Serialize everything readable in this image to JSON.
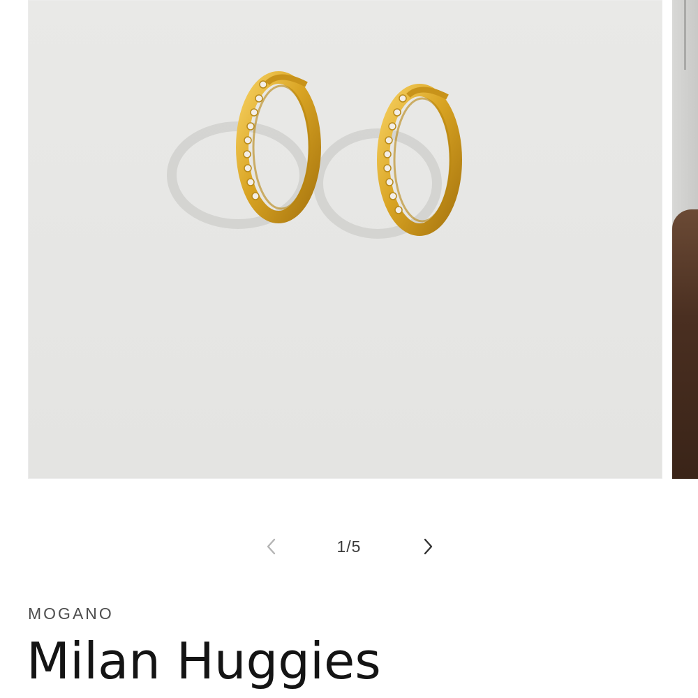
{
  "gallery": {
    "main_image_alt": "Gold pavé huggie hoop earrings",
    "current_index": 1,
    "total": 5
  },
  "pager": {
    "counter_text": "1/5",
    "prev_icon": "chevron-left-icon",
    "next_icon": "chevron-right-icon"
  },
  "product": {
    "vendor": "MOGANO",
    "title": "Milan Huggies"
  },
  "colors": {
    "gold": "#d9a423",
    "background": "#e8e8e6",
    "text": "#141414"
  }
}
